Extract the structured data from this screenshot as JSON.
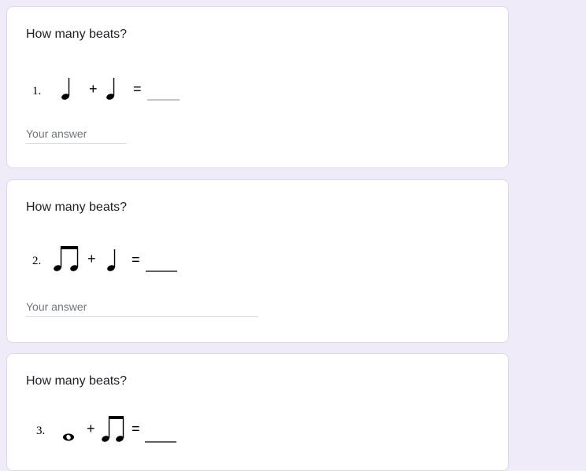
{
  "questions": [
    {
      "title": "How many beats?",
      "number": "1.",
      "placeholder": "Your answer"
    },
    {
      "title": "How many beats?",
      "number": "2.",
      "placeholder": "Your answer"
    },
    {
      "title": "How many beats?",
      "number": "3.",
      "placeholder": ""
    }
  ],
  "symbols": {
    "plus": "+",
    "equals": "="
  },
  "colors": {
    "background": "#f0ebf8",
    "card": "#ffffff",
    "border": "#dadce0",
    "text": "#202124",
    "placeholder": "#70757a"
  }
}
